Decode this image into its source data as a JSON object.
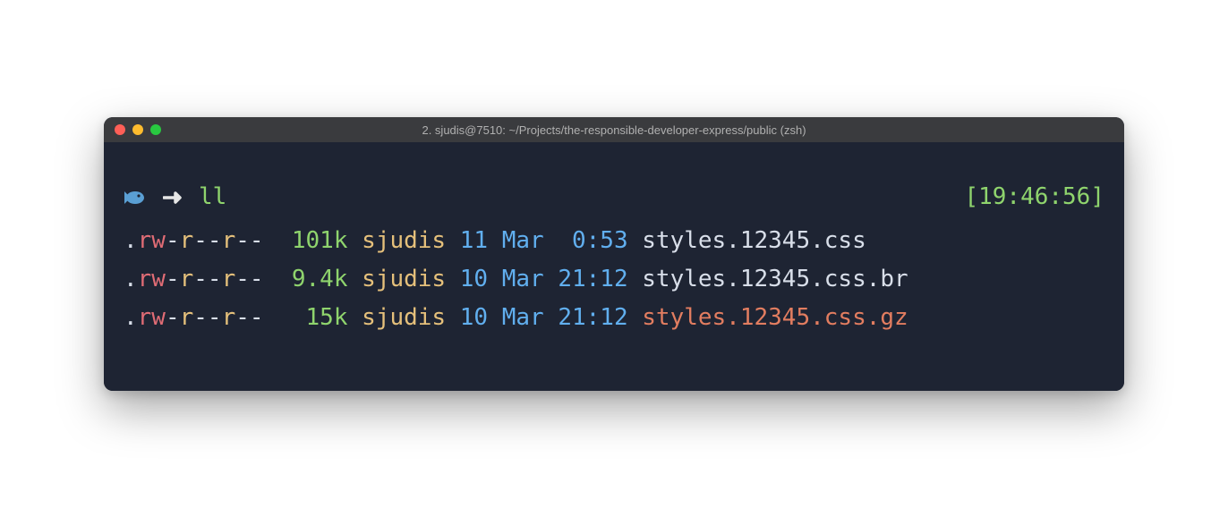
{
  "window": {
    "title": "2. sjudis@7510: ~/Projects/the-responsible-developer-express/public (zsh)"
  },
  "prompt": {
    "command": "ll",
    "timestamp": "[19:46:56]"
  },
  "listing": [
    {
      "perm_dot": ".",
      "perm_rw": "rw",
      "perm_sep1": "-",
      "perm_r1": "r",
      "perm_dash1": "--",
      "perm_r2": "r",
      "perm_dash2": "--",
      "size": "101k",
      "size_pad": " ",
      "user": "sjudis",
      "day": "11",
      "month": "Mar",
      "time": " 0:53",
      "filename": "styles.12345.css",
      "filename_color": "c-white"
    },
    {
      "perm_dot": ".",
      "perm_rw": "rw",
      "perm_sep1": "-",
      "perm_r1": "r",
      "perm_dash1": "--",
      "perm_r2": "r",
      "perm_dash2": "--",
      "size": "9.4k",
      "size_pad": " ",
      "user": "sjudis",
      "day": "10",
      "month": "Mar",
      "time": "21:12",
      "filename": "styles.12345.css.br",
      "filename_color": "c-white"
    },
    {
      "perm_dot": ".",
      "perm_rw": "rw",
      "perm_sep1": "-",
      "perm_r1": "r",
      "perm_dash1": "--",
      "perm_r2": "r",
      "perm_dash2": "--",
      "size": "15k",
      "size_pad": "  ",
      "user": "sjudis",
      "day": "10",
      "month": "Mar",
      "time": "21:12",
      "filename": "styles.12345.css.gz",
      "filename_color": "c-orange"
    }
  ]
}
